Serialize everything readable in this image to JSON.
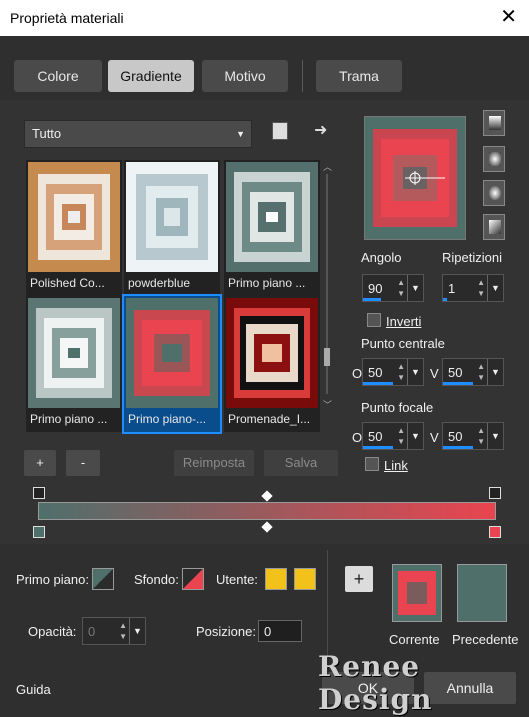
{
  "window": {
    "title": "Proprietà materiali",
    "close": "✕"
  },
  "tabs": [
    "Colore",
    "Gradiente",
    "Motivo",
    "Trama"
  ],
  "library": {
    "category": "Tutto",
    "tiles": [
      {
        "label": "Polished Co..."
      },
      {
        "label": "powderblue"
      },
      {
        "label": "Primo piano ..."
      },
      {
        "label": "Primo piano ..."
      },
      {
        "label": "Primo piano-..."
      },
      {
        "label": "Promenade_I..."
      }
    ],
    "add": "+",
    "remove": "-",
    "reset": "Reimposta",
    "save": "Salva"
  },
  "settings": {
    "angle_label": "Angolo",
    "angle_value": "90",
    "repeats_label": "Ripetizioni",
    "repeats_value": "1",
    "invert_label": "Inverti",
    "center_label": "Punto centrale",
    "center_o_prefix": "O",
    "center_o": "50",
    "center_v_prefix": "V",
    "center_v": "50",
    "focal_label": "Punto focale",
    "focal_o_prefix": "O",
    "focal_o": "50",
    "focal_v_prefix": "V",
    "focal_v": "50",
    "link_label": "Link"
  },
  "materials": {
    "foreground_label": "Primo piano:",
    "background_label": "Sfondo:",
    "user_label": "Utente:",
    "opacity_label": "Opacità:",
    "opacity_value": "0",
    "position_label": "Posizione:",
    "position_value": "0",
    "current_label": "Corrente",
    "previous_label": "Precedente",
    "add": "+"
  },
  "footer": {
    "help": "Guida",
    "ok": "OK",
    "cancel": "Annulla"
  },
  "watermark": "Renee Design",
  "colors": {
    "teal": "#4f6f6b",
    "red": "#e9444f",
    "gold": "#f2c21b",
    "accent": "#1f8cff"
  }
}
